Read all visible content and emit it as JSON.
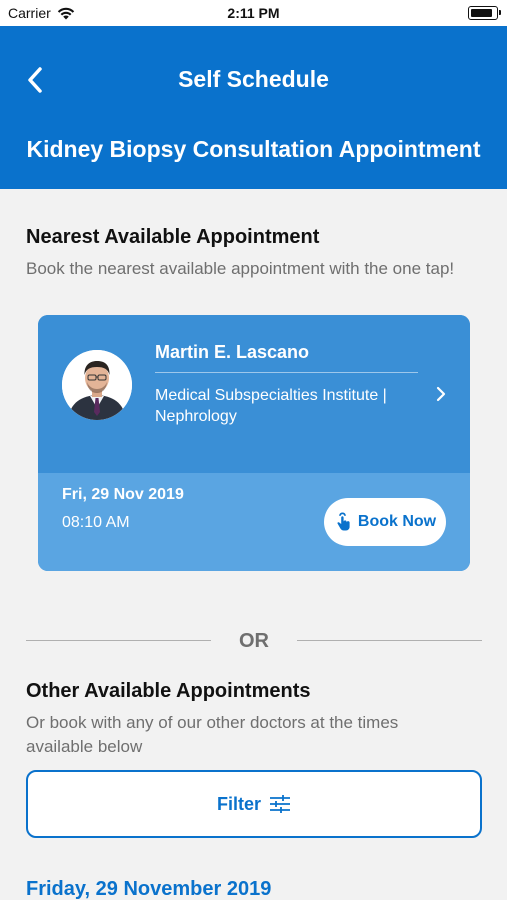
{
  "status_bar": {
    "carrier": "Carrier",
    "time": "2:11 PM",
    "battery_level": 0.9
  },
  "header": {
    "title": "Self Schedule",
    "subtitle": "Kidney Biopsy Consultation Appointment",
    "back_icon": "chevron-left-icon"
  },
  "nearest": {
    "heading": "Nearest Available Appointment",
    "description": "Book the nearest available appointment with the one tap!",
    "card": {
      "doctor_name": "Martin E. Lascano",
      "institute": "Medical Subspecialties Institute | Nephrology",
      "date": "Fri, 29 Nov 2019",
      "time": "08:10 AM",
      "book_label": "Book Now"
    }
  },
  "separator": {
    "text": "OR"
  },
  "other": {
    "heading": "Other Available Appointments",
    "description": "Or book with any of our other doctors at the times available below",
    "filter_label": "Filter",
    "date_heading": "Friday, 29 November 2019"
  },
  "colors": {
    "primary": "#0a72cc",
    "card_top": "#3a8fd6",
    "card_bottom": "#5aa5e2",
    "background": "#f2f2f2"
  }
}
